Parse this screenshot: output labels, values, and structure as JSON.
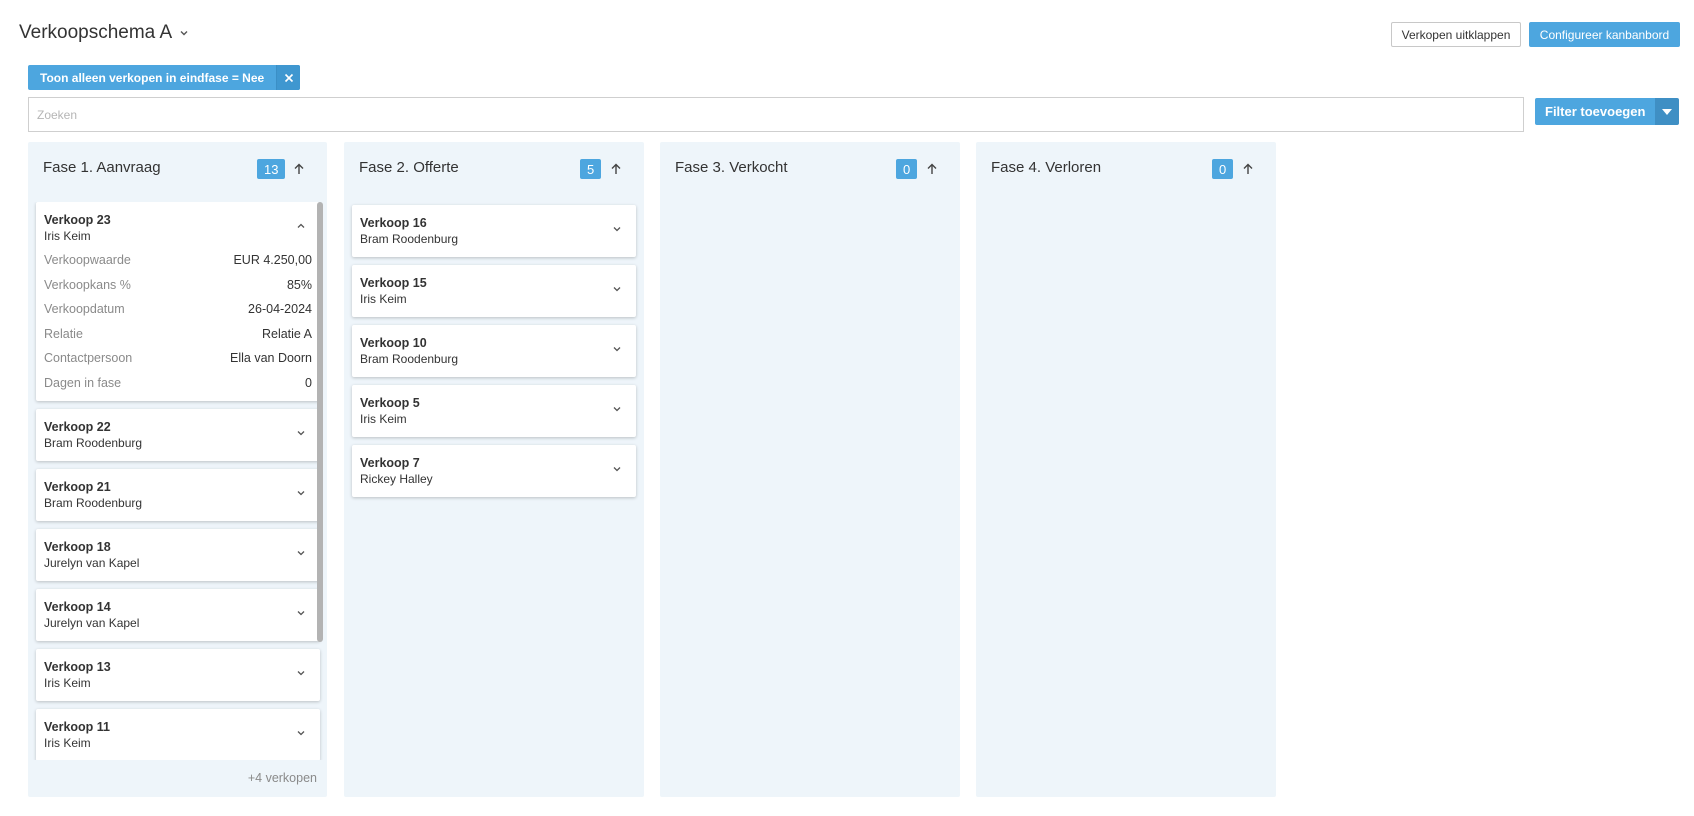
{
  "header": {
    "title": "Verkoopschema A",
    "expand_button": "Verkopen uitklappen",
    "configure_button": "Configureer kanbanbord"
  },
  "filter_chip": {
    "label": "Toon alleen verkopen in eindfase = Nee"
  },
  "search": {
    "placeholder": "Zoeken",
    "value": ""
  },
  "filter_button": {
    "label": "Filter toevoegen"
  },
  "colors": {
    "accent": "#4da6df",
    "column_bg": "#eef5fa"
  },
  "columns": [
    {
      "title": "Fase 1. Aanvraag",
      "count": "13",
      "more": "+4 verkopen",
      "cards": [
        {
          "title": "Verkoop 23",
          "person": "Iris Keim",
          "expanded": true,
          "details": [
            {
              "label": "Verkoopwaarde",
              "value": "EUR 4.250,00"
            },
            {
              "label": "Verkoopkans %",
              "value": "85%"
            },
            {
              "label": "Verkoopdatum",
              "value": "26-04-2024"
            },
            {
              "label": "Relatie",
              "value": "Relatie A"
            },
            {
              "label": "Contactpersoon",
              "value": "Ella van Doorn"
            },
            {
              "label": "Dagen in fase",
              "value": "0"
            }
          ]
        },
        {
          "title": "Verkoop 22",
          "person": "Bram Roodenburg"
        },
        {
          "title": "Verkoop 21",
          "person": "Bram Roodenburg"
        },
        {
          "title": "Verkoop 18",
          "person": "Jurelyn van Kapel"
        },
        {
          "title": "Verkoop 14",
          "person": "Jurelyn van Kapel"
        },
        {
          "title": "Verkoop 13",
          "person": "Iris Keim"
        },
        {
          "title": "Verkoop 11",
          "person": "Iris Keim"
        }
      ]
    },
    {
      "title": "Fase 2. Offerte",
      "count": "5",
      "cards": [
        {
          "title": "Verkoop 16",
          "person": "Bram Roodenburg"
        },
        {
          "title": "Verkoop 15",
          "person": "Iris Keim"
        },
        {
          "title": "Verkoop 10",
          "person": "Bram Roodenburg"
        },
        {
          "title": "Verkoop 5",
          "person": "Iris Keim"
        },
        {
          "title": "Verkoop 7",
          "person": "Rickey Halley"
        }
      ]
    },
    {
      "title": "Fase 3. Verkocht",
      "count": "0",
      "cards": []
    },
    {
      "title": "Fase 4. Verloren",
      "count": "0",
      "cards": []
    }
  ]
}
